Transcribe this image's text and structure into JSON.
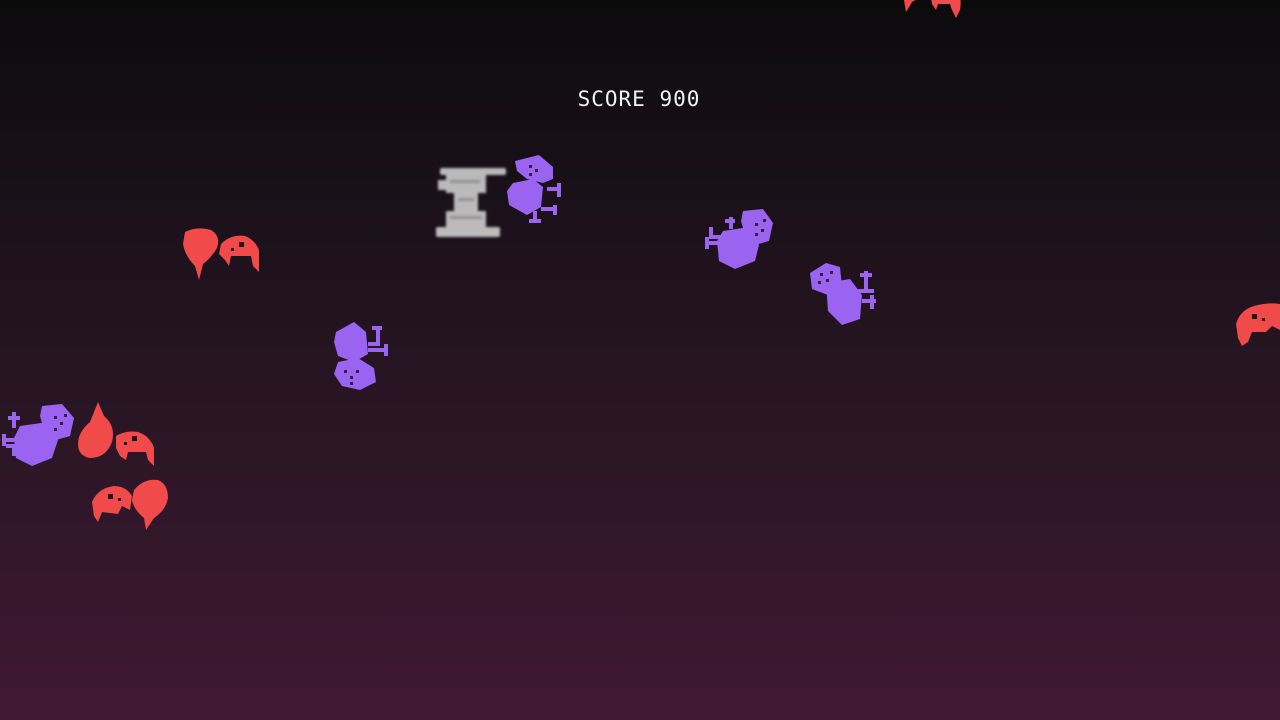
{
  "hud": {
    "score_label": "SCORE",
    "score_value": "900"
  },
  "colors": {
    "enemy_red": "#f04a4a",
    "enemy_purple": "#9a63f0",
    "player": "#d8d8d8",
    "hud_text": "#f2f2f2",
    "bg_top": "#0c0b0c",
    "bg_bottom": "#411832"
  },
  "sprites": {
    "player": "player-ship",
    "red_enemy": "red-fish-creature",
    "purple_enemy": "purple-tentacle-creature"
  }
}
